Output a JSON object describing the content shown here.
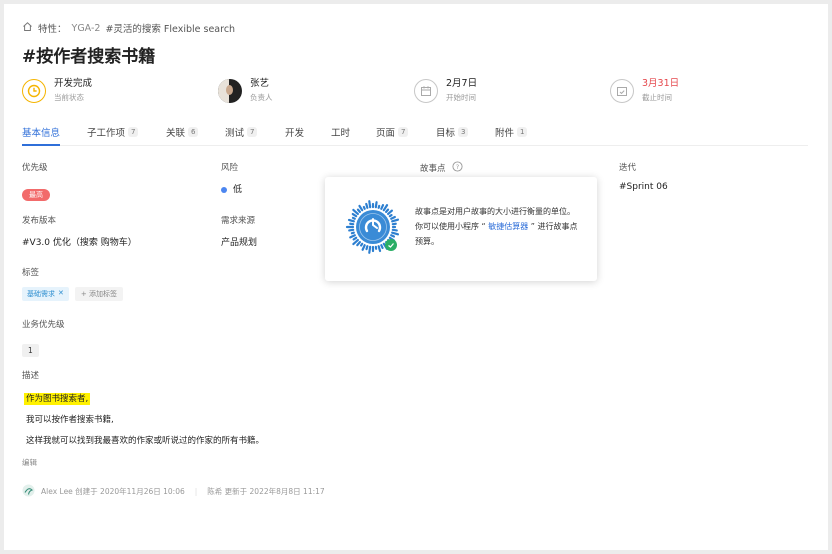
{
  "breadcrumb": {
    "feature_label": "特性：",
    "issue_id": "YGA-2",
    "parent_title": "#灵活的搜索 Flexible search"
  },
  "page_title": "#按作者搜索书籍",
  "meta": {
    "status": {
      "value": "开发完成",
      "label": "当前状态"
    },
    "assignee": {
      "value": "张艺",
      "label": "负责人"
    },
    "start": {
      "value": "2月7日",
      "label": "开始时间"
    },
    "due": {
      "value": "3月31日",
      "label": "截止时间",
      "color": "#e5484d"
    }
  },
  "tabs": [
    {
      "label": "基本信息",
      "count": ""
    },
    {
      "label": "子工作项",
      "count": "7"
    },
    {
      "label": "关联",
      "count": "6"
    },
    {
      "label": "测试",
      "count": "7"
    },
    {
      "label": "开发",
      "count": ""
    },
    {
      "label": "工时",
      "count": ""
    },
    {
      "label": "页面",
      "count": "7"
    },
    {
      "label": "目标",
      "count": "3"
    },
    {
      "label": "附件",
      "count": "1"
    }
  ],
  "fields": {
    "priority": {
      "label": "优先级",
      "value": "最高"
    },
    "risk": {
      "label": "风险",
      "value": "低"
    },
    "story_points": {
      "label": "故事点"
    },
    "iteration": {
      "label": "迭代",
      "value": "#Sprint 06"
    },
    "release": {
      "label": "发布版本",
      "value": "#V3.0 优化（搜索 购物车）"
    },
    "source": {
      "label": "需求来源",
      "value": "产品规划"
    },
    "tags": {
      "label": "标签",
      "tag": "基础需求",
      "add": "+ 添加标签"
    },
    "biz_priority": {
      "label": "业务优先级",
      "value": "1"
    },
    "description": {
      "label": "描述",
      "line1": "作为图书搜索者,",
      "line2": "我可以按作者搜索书籍,",
      "line3": "这样我就可以找到我最喜欢的作家或听说过的作家的所有书籍。"
    },
    "edit": "编辑"
  },
  "footer": {
    "creator": "Alex Lee 创建于 2020年11月26日 10:06",
    "updater": "陈希 更新于 2022年8月8日 11:17"
  },
  "popover": {
    "text_pre": "故事点是对用户故事的大小进行衡量的单位。你可以使用小程序 “ ",
    "link": "敏捷估算器",
    "text_post": " ” 进行故事点预算。"
  },
  "colors": {
    "accent": "#2f6fd9",
    "priority_red": "#f26b6b",
    "highlight": "#fff100",
    "status_yellow": "#f5b400"
  }
}
